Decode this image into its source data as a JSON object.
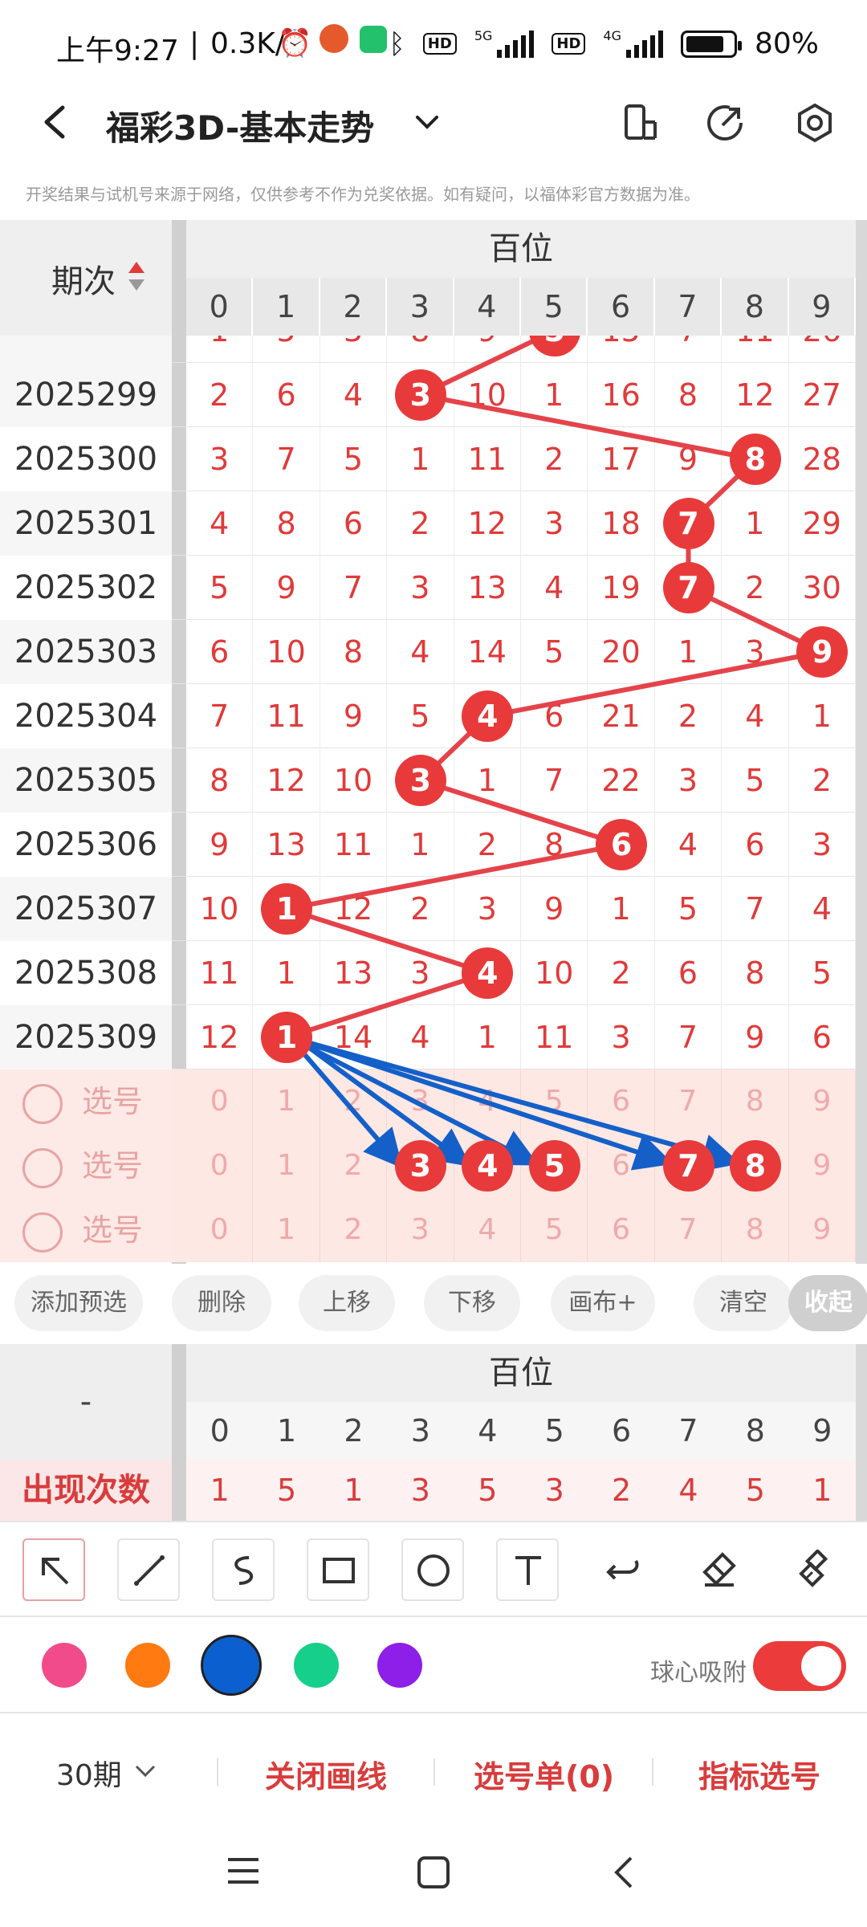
{
  "status_bar": {
    "time": "上午9:27",
    "speed": "0.3K/s",
    "hd1": "HD",
    "net1": "5G",
    "hd2": "HD",
    "net2": "4G",
    "battery": "80%"
  },
  "header": {
    "title": "福彩3D-基本走势"
  },
  "disclaimer": "开奖结果与试机号来源于网络，仅供参考不作为兑奖依据。如有疑问，以福体彩官方数据为准。",
  "table": {
    "period_header": "期次",
    "group_header": "百位",
    "columns": [
      "0",
      "1",
      "2",
      "3",
      "4",
      "5",
      "6",
      "7",
      "8",
      "9"
    ],
    "partial_top_row": [
      "1",
      "5",
      "3",
      "8",
      "9",
      "5",
      "15",
      "7",
      "11",
      "26"
    ],
    "rows": [
      {
        "period": "2025299",
        "cells": [
          "2",
          "6",
          "4",
          "3",
          "10",
          "1",
          "16",
          "8",
          "12",
          "27"
        ],
        "hit": 3
      },
      {
        "period": "2025300",
        "cells": [
          "3",
          "7",
          "5",
          "1",
          "11",
          "2",
          "17",
          "9",
          "8",
          "28"
        ],
        "hit": 8
      },
      {
        "period": "2025301",
        "cells": [
          "4",
          "8",
          "6",
          "2",
          "12",
          "3",
          "18",
          "7",
          "1",
          "29"
        ],
        "hit": 7
      },
      {
        "period": "2025302",
        "cells": [
          "5",
          "9",
          "7",
          "3",
          "13",
          "4",
          "19",
          "7",
          "2",
          "30"
        ],
        "hit": 7
      },
      {
        "period": "2025303",
        "cells": [
          "6",
          "10",
          "8",
          "4",
          "14",
          "5",
          "20",
          "1",
          "3",
          "9"
        ],
        "hit": 9
      },
      {
        "period": "2025304",
        "cells": [
          "7",
          "11",
          "9",
          "5",
          "4",
          "6",
          "21",
          "2",
          "4",
          "1"
        ],
        "hit": 4
      },
      {
        "period": "2025305",
        "cells": [
          "8",
          "12",
          "10",
          "3",
          "1",
          "7",
          "22",
          "3",
          "5",
          "2"
        ],
        "hit": 3
      },
      {
        "period": "2025306",
        "cells": [
          "9",
          "13",
          "11",
          "1",
          "2",
          "8",
          "6",
          "4",
          "6",
          "3"
        ],
        "hit": 6
      },
      {
        "period": "2025307",
        "cells": [
          "10",
          "1",
          "12",
          "2",
          "3",
          "9",
          "1",
          "5",
          "7",
          "4"
        ],
        "hit": 1
      },
      {
        "period": "2025308",
        "cells": [
          "11",
          "1",
          "13",
          "3",
          "4",
          "10",
          "2",
          "6",
          "8",
          "5"
        ],
        "hit": 4
      },
      {
        "period": "2025309",
        "cells": [
          "12",
          "1",
          "14",
          "4",
          "1",
          "11",
          "3",
          "7",
          "9",
          "6"
        ],
        "hit": 1
      }
    ],
    "pick_rows": [
      {
        "label": "选号",
        "cells": [
          "0",
          "1",
          "2",
          "3",
          "4",
          "5",
          "6",
          "7",
          "8",
          "9"
        ],
        "selected": []
      },
      {
        "label": "选号",
        "cells": [
          "0",
          "1",
          "2",
          "3",
          "4",
          "5",
          "6",
          "7",
          "8",
          "9"
        ],
        "selected": [
          3,
          4,
          5,
          7,
          8
        ]
      },
      {
        "label": "选号",
        "cells": [
          "0",
          "1",
          "2",
          "3",
          "4",
          "5",
          "6",
          "7",
          "8",
          "9"
        ],
        "selected": []
      }
    ]
  },
  "actions": [
    "添加预选",
    "删除",
    "上移",
    "下移",
    "画布+",
    "清空",
    "收起"
  ],
  "stats": {
    "left_header": "-",
    "group_header": "百位",
    "columns": [
      "0",
      "1",
      "2",
      "3",
      "4",
      "5",
      "6",
      "7",
      "8",
      "9"
    ],
    "row_label": "出现次数",
    "values": [
      "1",
      "5",
      "1",
      "3",
      "5",
      "3",
      "2",
      "4",
      "5",
      "1"
    ]
  },
  "tools": [
    "arrow-pointer",
    "line",
    "curve",
    "rectangle",
    "circle",
    "text",
    "undo",
    "eraser",
    "clear-brush"
  ],
  "palette": [
    "#f24b8c",
    "#ff7a10",
    "#0b5fce",
    "#16cf8b",
    "#8d1fe8"
  ],
  "snap_label": "球心吸附",
  "bottom": {
    "period": "30期",
    "close_draw": "关闭画线",
    "pick_list": "选号单(0)",
    "indicator_pick": "指标选号"
  }
}
